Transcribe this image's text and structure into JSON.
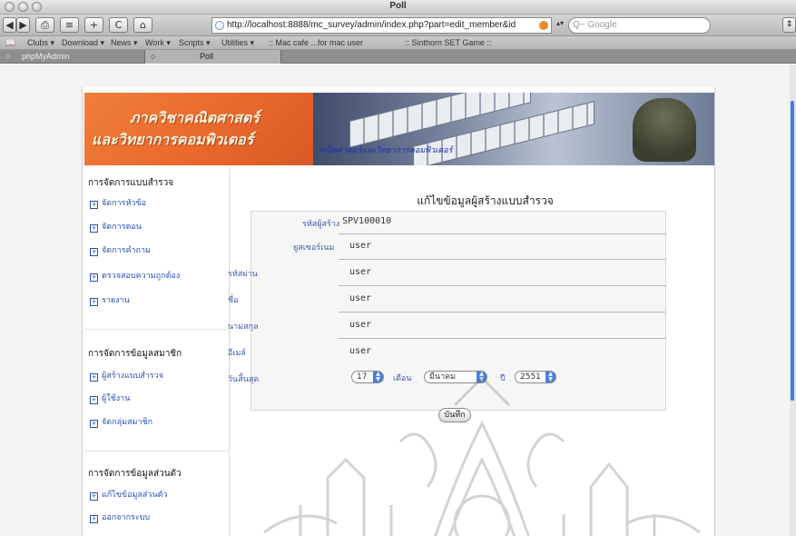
{
  "window": {
    "title": "Poll"
  },
  "toolbar": {
    "back": "◀",
    "forward": "▶",
    "print": "⎙",
    "reader": "≡",
    "add": "+",
    "reload": "C",
    "home": "⌂",
    "url": "http://localhost:8888/mc_survey/admin/index.php?part=edit_member&id",
    "search_placeholder": "Q~ Google",
    "side": "⇕"
  },
  "bookmarks": [
    "Clubs ▾",
    "Download ▾",
    "News ▾",
    "Work ▾",
    "Scripts ▾",
    "Utilities ▾",
    ":: Mac cafe ...for mac user",
    ":: Sinthorn SET Game ::"
  ],
  "tabs": [
    {
      "label": "phpMyAdmin",
      "active": false
    },
    {
      "label": "Poll",
      "active": true
    }
  ],
  "banner": {
    "line1": "ภาควิชาคณิตศาสตร์",
    "line2": "และวิทยาการคอมพิวเตอร์",
    "tagline": "คณิตศาสตร์และวิทยาการคอมพิวเตอร์"
  },
  "sidebar": {
    "sections": [
      {
        "heading": "การจัดการแบบสำรวจ",
        "items": [
          "จัดการหัวข้อ",
          "จัดการตอน",
          "จัดการคำถาม",
          "ตรวจสอบความถูกต้อง",
          "รายงาน"
        ]
      },
      {
        "heading": "การจัดการข้อมูลสมาชิก",
        "items": [
          "ผู้สร้างแบบสำรวจ",
          "ผู้ใช้งาน",
          "จัดกลุ่มสมาชิก"
        ]
      },
      {
        "heading": "การจัดการข้อมูลส่วนตัว",
        "items": [
          "แก้ไขข้อมูลส่วนตัว",
          "ออกจากระบบ"
        ]
      }
    ]
  },
  "form": {
    "title": "แก้ไขข้อมูลผู้สร้างแบบสำรวจ",
    "fields": [
      {
        "label": "รหัสผู้สร้าง",
        "value": "SPV100010"
      },
      {
        "label": "ยูสเซอร์เนม",
        "value": "user"
      },
      {
        "label": "รหัสผ่าน",
        "value": "user"
      },
      {
        "label": "ชื่อ",
        "value": "user"
      },
      {
        "label": "นามสกุล",
        "value": "user"
      },
      {
        "label": "อีเมล์",
        "value": "user"
      }
    ],
    "expiry": {
      "label": "วันสิ้นสุด",
      "day": "17",
      "month_label": "เดือน",
      "month": "มีนาคม",
      "year_label": "ปี",
      "year": "2551"
    },
    "save_label": "บันทึก"
  },
  "colors": {
    "banner_orange": "#e9682c",
    "link_blue": "#2a4fb5",
    "label_blue": "#3b5aa8"
  }
}
